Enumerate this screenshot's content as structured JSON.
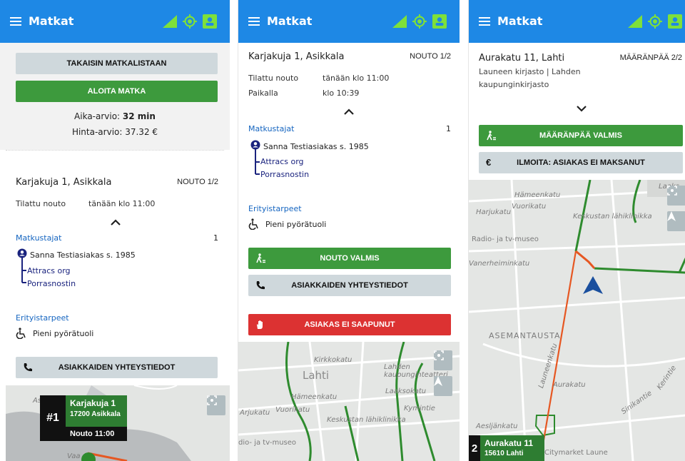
{
  "app_title": "Matkat",
  "colors": {
    "primary": "#1e88e5",
    "green": "#3d9a3d",
    "red": "#dc3232",
    "grey_button": "#cfd8dc",
    "route_green": "#2e8b2e",
    "route_orange": "#e65722"
  },
  "icons": {
    "menu": "hamburger-menu-icon",
    "signal": "signal-icon",
    "location": "gps-target-icon",
    "profile": "contact-card-icon"
  },
  "panel1": {
    "back_button": "TAKAISIN MATKALISTAAN",
    "start_button": "ALOITA MATKA",
    "time_label": "Aika-arvio: ",
    "time_value": "32 min",
    "price_label": "Hinta-arvio: 37.32 €",
    "address": "Karjakuja 1, Asikkala",
    "stop_label": "NOUTO 1/2",
    "ordered_label": "Tilattu nouto",
    "ordered_value": "tänään klo 11:00",
    "passengers_label": "Matkustajat",
    "passengers_count": "1",
    "passenger_name": "Sanna Testiasiakas s. 1985",
    "org": "Attracs org",
    "service": "Porrasnostin",
    "needs_label": "Erityistarpeet",
    "need": "Pieni pyörätuoli",
    "contact_button": "ASIAKKAIDEN YHTEYSTIEDOT",
    "map": {
      "card_number": "#1",
      "card_line1": "Karjakuja 1",
      "card_line2": "17200 Asikkala",
      "card_line3": "Nouto  11:00",
      "labels": [
        "As",
        "Vaa"
      ]
    }
  },
  "panel2": {
    "address": "Karjakuja 1, Asikkala",
    "stop_label": "NOUTO 1/2",
    "ordered_label": "Tilattu nouto",
    "ordered_value": "tänään klo 11:00",
    "arrived_label": "Paikalla",
    "arrived_value": "klo 10:39",
    "passengers_label": "Matkustajat",
    "passengers_count": "1",
    "passenger_name": "Sanna Testiasiakas s. 1985",
    "org": "Attracs org",
    "service": "Porrasnostin",
    "needs_label": "Erityistarpeet",
    "need": "Pieni pyörätuoli",
    "pickup_done_button": "NOUTO VALMIS",
    "contact_button": "ASIAKKAIDEN YHTEYSTIEDOT",
    "no_show_button": "ASIAKAS EI SAAPUNUT",
    "map": {
      "labels": [
        "Kirkkokatu",
        "Lahti",
        "Lahden kaupunginteatteri",
        "Laaksokatu",
        "Hämeenkatu",
        "Vuorikatu",
        "Arjukatu",
        "Kymintie",
        "Keskustan lähiklinikka",
        "dio- ja tv-museo"
      ]
    }
  },
  "panel3": {
    "address": "Aurakatu 11, Lahti",
    "stop_label": "MÄÄRÄNPÄÄ 2/2",
    "sub1": "Launeen kirjasto | Lahden",
    "sub2": "kaupunginkirjasto",
    "dest_done_button": "MÄÄRÄNPÄÄ VALMIS",
    "not_paid_button": "ILMOITA: ASIAKAS EI MAKSANUT",
    "map": {
      "labels": [
        "Hämeenkatu",
        "Harjukatu",
        "Vuorikatu",
        "Keskustan lähiklinikka",
        "Radio- ja tv-museo",
        "Vanerheiminkatu",
        "ASEMANTAUSTA",
        "Launeenkatu",
        "Aurakatu",
        "Kerintie",
        "Sinikantie",
        "Aesljänkatu",
        "Citymarket Laune",
        "Laaks"
      ],
      "card_number": "2",
      "card_line1": "Aurakatu 11",
      "card_line2": "15610 Lahti"
    }
  }
}
